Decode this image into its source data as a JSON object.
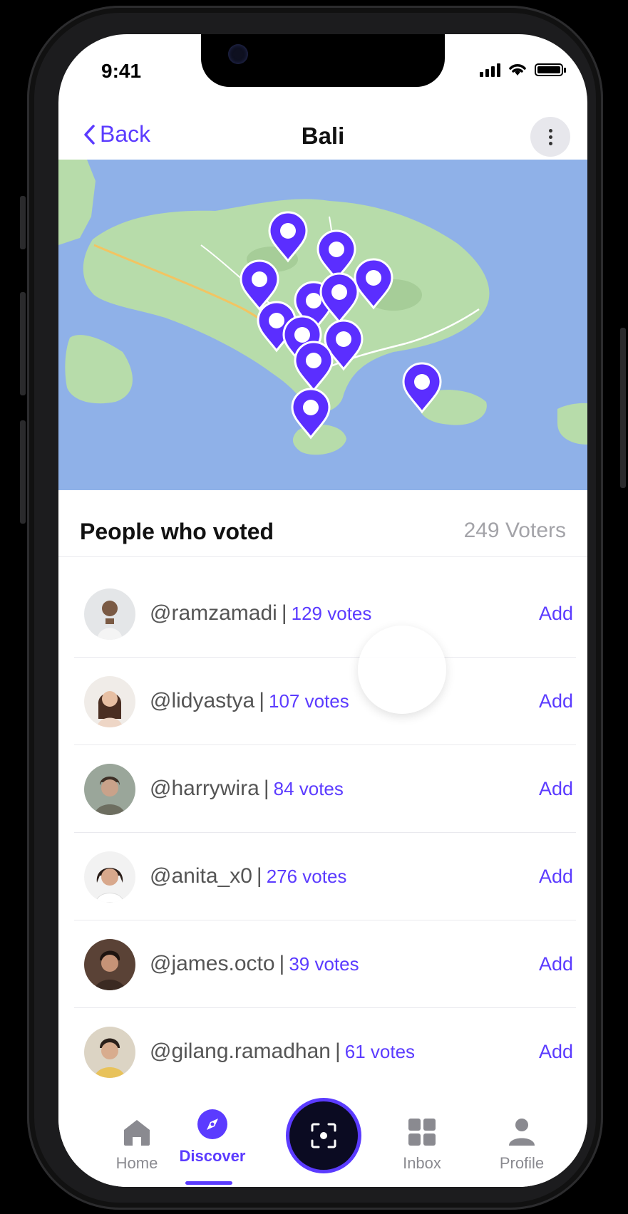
{
  "status_bar": {
    "time": "9:41"
  },
  "nav": {
    "back_label": "Back",
    "title": "Bali"
  },
  "voters": {
    "heading": "People who voted",
    "count_label": "249 Voters"
  },
  "voter_list": [
    {
      "handle": "@ramzamadi",
      "votes": "129 votes",
      "action": "Add"
    },
    {
      "handle": "@lidyastya",
      "votes": "107 votes",
      "action": "Add"
    },
    {
      "handle": "@harrywira",
      "votes": "84 votes",
      "action": "Add"
    },
    {
      "handle": "@anita_x0",
      "votes": "276 votes",
      "action": "Add"
    },
    {
      "handle": "@james.octo",
      "votes": "39 votes",
      "action": "Add"
    },
    {
      "handle": "@gilang.ramadhan",
      "votes": "61 votes",
      "action": "Add"
    }
  ],
  "tabbar": {
    "home": "Home",
    "discover": "Discover",
    "inbox": "Inbox",
    "profile": "Profile"
  },
  "colors": {
    "accent": "#5b3bff",
    "map_water": "#8fb1e8",
    "map_land": "#b7dcaa"
  }
}
